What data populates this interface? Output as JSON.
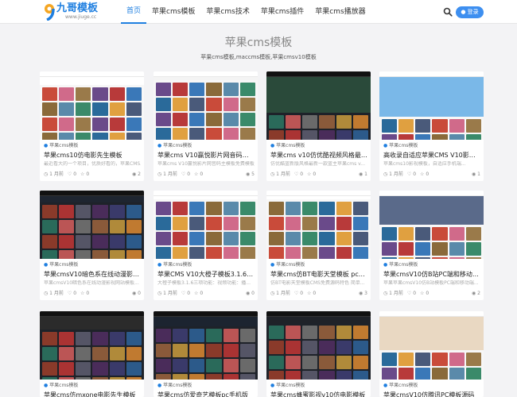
{
  "site": {
    "logo_text": "九哥模板",
    "logo_sub": "www.jiuge.cc"
  },
  "nav": {
    "items": [
      {
        "label": "首页",
        "active": true
      },
      {
        "label": "苹果cms模板",
        "active": false
      },
      {
        "label": "苹果cms技术",
        "active": false
      },
      {
        "label": "苹果cms插件",
        "active": false
      },
      {
        "label": "苹果cms播放器",
        "active": false
      }
    ]
  },
  "header": {
    "search_icon": "search-icon",
    "login_label": "登录"
  },
  "page": {
    "title": "苹果cms模板",
    "subtitle": "苹果cms模板,maccms模板,苹果cmsv10模板"
  },
  "colors": {
    "accent": "#1f7fe0",
    "button": "#3d8ff0"
  },
  "cards": [
    {
      "category": "苹果cms模板",
      "title": "苹果cms10仿电影先生模板",
      "desc": "最近看大的一个项目，优质好看的，苹果CMS...",
      "time": "1 月前",
      "likes": "0",
      "favs": "0",
      "views": "2",
      "theme": "light",
      "banner": "#ffffff",
      "banner_h": 10
    },
    {
      "category": "苹果cms模板",
      "title": "苹果cms V10赢悦影片网音码模板",
      "desc": "苹果cms V10赢悦影片网音码主模板免费模板...",
      "time": "1 月前",
      "likes": "0",
      "favs": "0",
      "views": "5",
      "theme": "light",
      "banner": "#f4f4f4",
      "banner_h": 4
    },
    {
      "category": "苹果cms模板",
      "title": "苹果cms v10仿优酷视频风格最新...",
      "desc": "仿优酷蓝新版风格最新一款蓝主苹果cms v...",
      "time": "1 月前",
      "likes": "0",
      "favs": "0",
      "views": "1",
      "theme": "dark",
      "banner": "#2a4a3a",
      "banner_h": 45
    },
    {
      "category": "苹果cms模板",
      "title": "高收录自适应苹果CMS V10影视...",
      "desc": "苹果cms10影视模板，自适应手机端...",
      "time": "1 月前",
      "likes": "0",
      "favs": "0",
      "views": "1",
      "theme": "light",
      "banner": "#7ab8e8",
      "banner_h": 50
    },
    {
      "category": "苹果cms模板",
      "title": "苹果cmsV10暗色系在线动漫影视...",
      "desc": "苹果cmsV10暗色系在线动漫影视网站模板...",
      "time": "1 月前",
      "likes": "0",
      "favs": "0",
      "views": "0",
      "theme": "dark",
      "banner": "#1e2530",
      "banner_h": 8
    },
    {
      "category": "苹果cms模板",
      "title": "苹果CMS V10大橙子模板3.1.6去...",
      "desc": "大橙子模板3.1.6三项功能：视频功能：播...",
      "time": "1 月前",
      "likes": "0",
      "favs": "0",
      "views": "0",
      "theme": "light",
      "banner": "#ffffff",
      "banner_h": 4
    },
    {
      "category": "苹果cms模板",
      "title": "苹果cms仿BT电影天堂模板 pc+w...",
      "desc": "仿BT电影天堂模板CMS免费源码特色 简单...",
      "time": "1 月前",
      "likes": "0",
      "favs": "0",
      "views": "3",
      "theme": "light",
      "banner": "#ffffff",
      "banner_h": 4
    },
    {
      "category": "苹果cms模板",
      "title": "苹果cmsV10仿B站PC端和移动端...",
      "desc": "苹果苹果cmsV10仿B站模板PC端和移动端...",
      "time": "1 月前",
      "likes": "0",
      "favs": "0",
      "views": "2",
      "theme": "light",
      "banner": "#5a6a8a",
      "banner_h": 36
    },
    {
      "category": "苹果cms模板",
      "title": "苹果cms仿mxone电影先生模板",
      "desc": "",
      "time": "",
      "likes": "",
      "favs": "",
      "views": "",
      "theme": "dark",
      "banner": "#2b2b2b",
      "banner_h": 16
    },
    {
      "category": "苹果cms模板",
      "title": "苹果cms仿爱奇艺模板pc手机版",
      "desc": "",
      "time": "",
      "likes": "",
      "favs": "",
      "views": "",
      "theme": "dark",
      "banner": "#1c2430",
      "banner_h": 12
    },
    {
      "category": "苹果cms模板",
      "title": "苹果cms蜂蜜影视v10仿电影模板",
      "desc": "",
      "time": "",
      "likes": "",
      "favs": "",
      "views": "",
      "theme": "dark",
      "banner": "#1f2228",
      "banner_h": 8
    },
    {
      "category": "苹果cms模板",
      "title": "苹果cmsV10仿腾讯PC模板源码",
      "desc": "",
      "time": "",
      "likes": "",
      "favs": "",
      "views": "",
      "theme": "light",
      "banner": "#e9d8c2",
      "banner_h": 42
    }
  ]
}
